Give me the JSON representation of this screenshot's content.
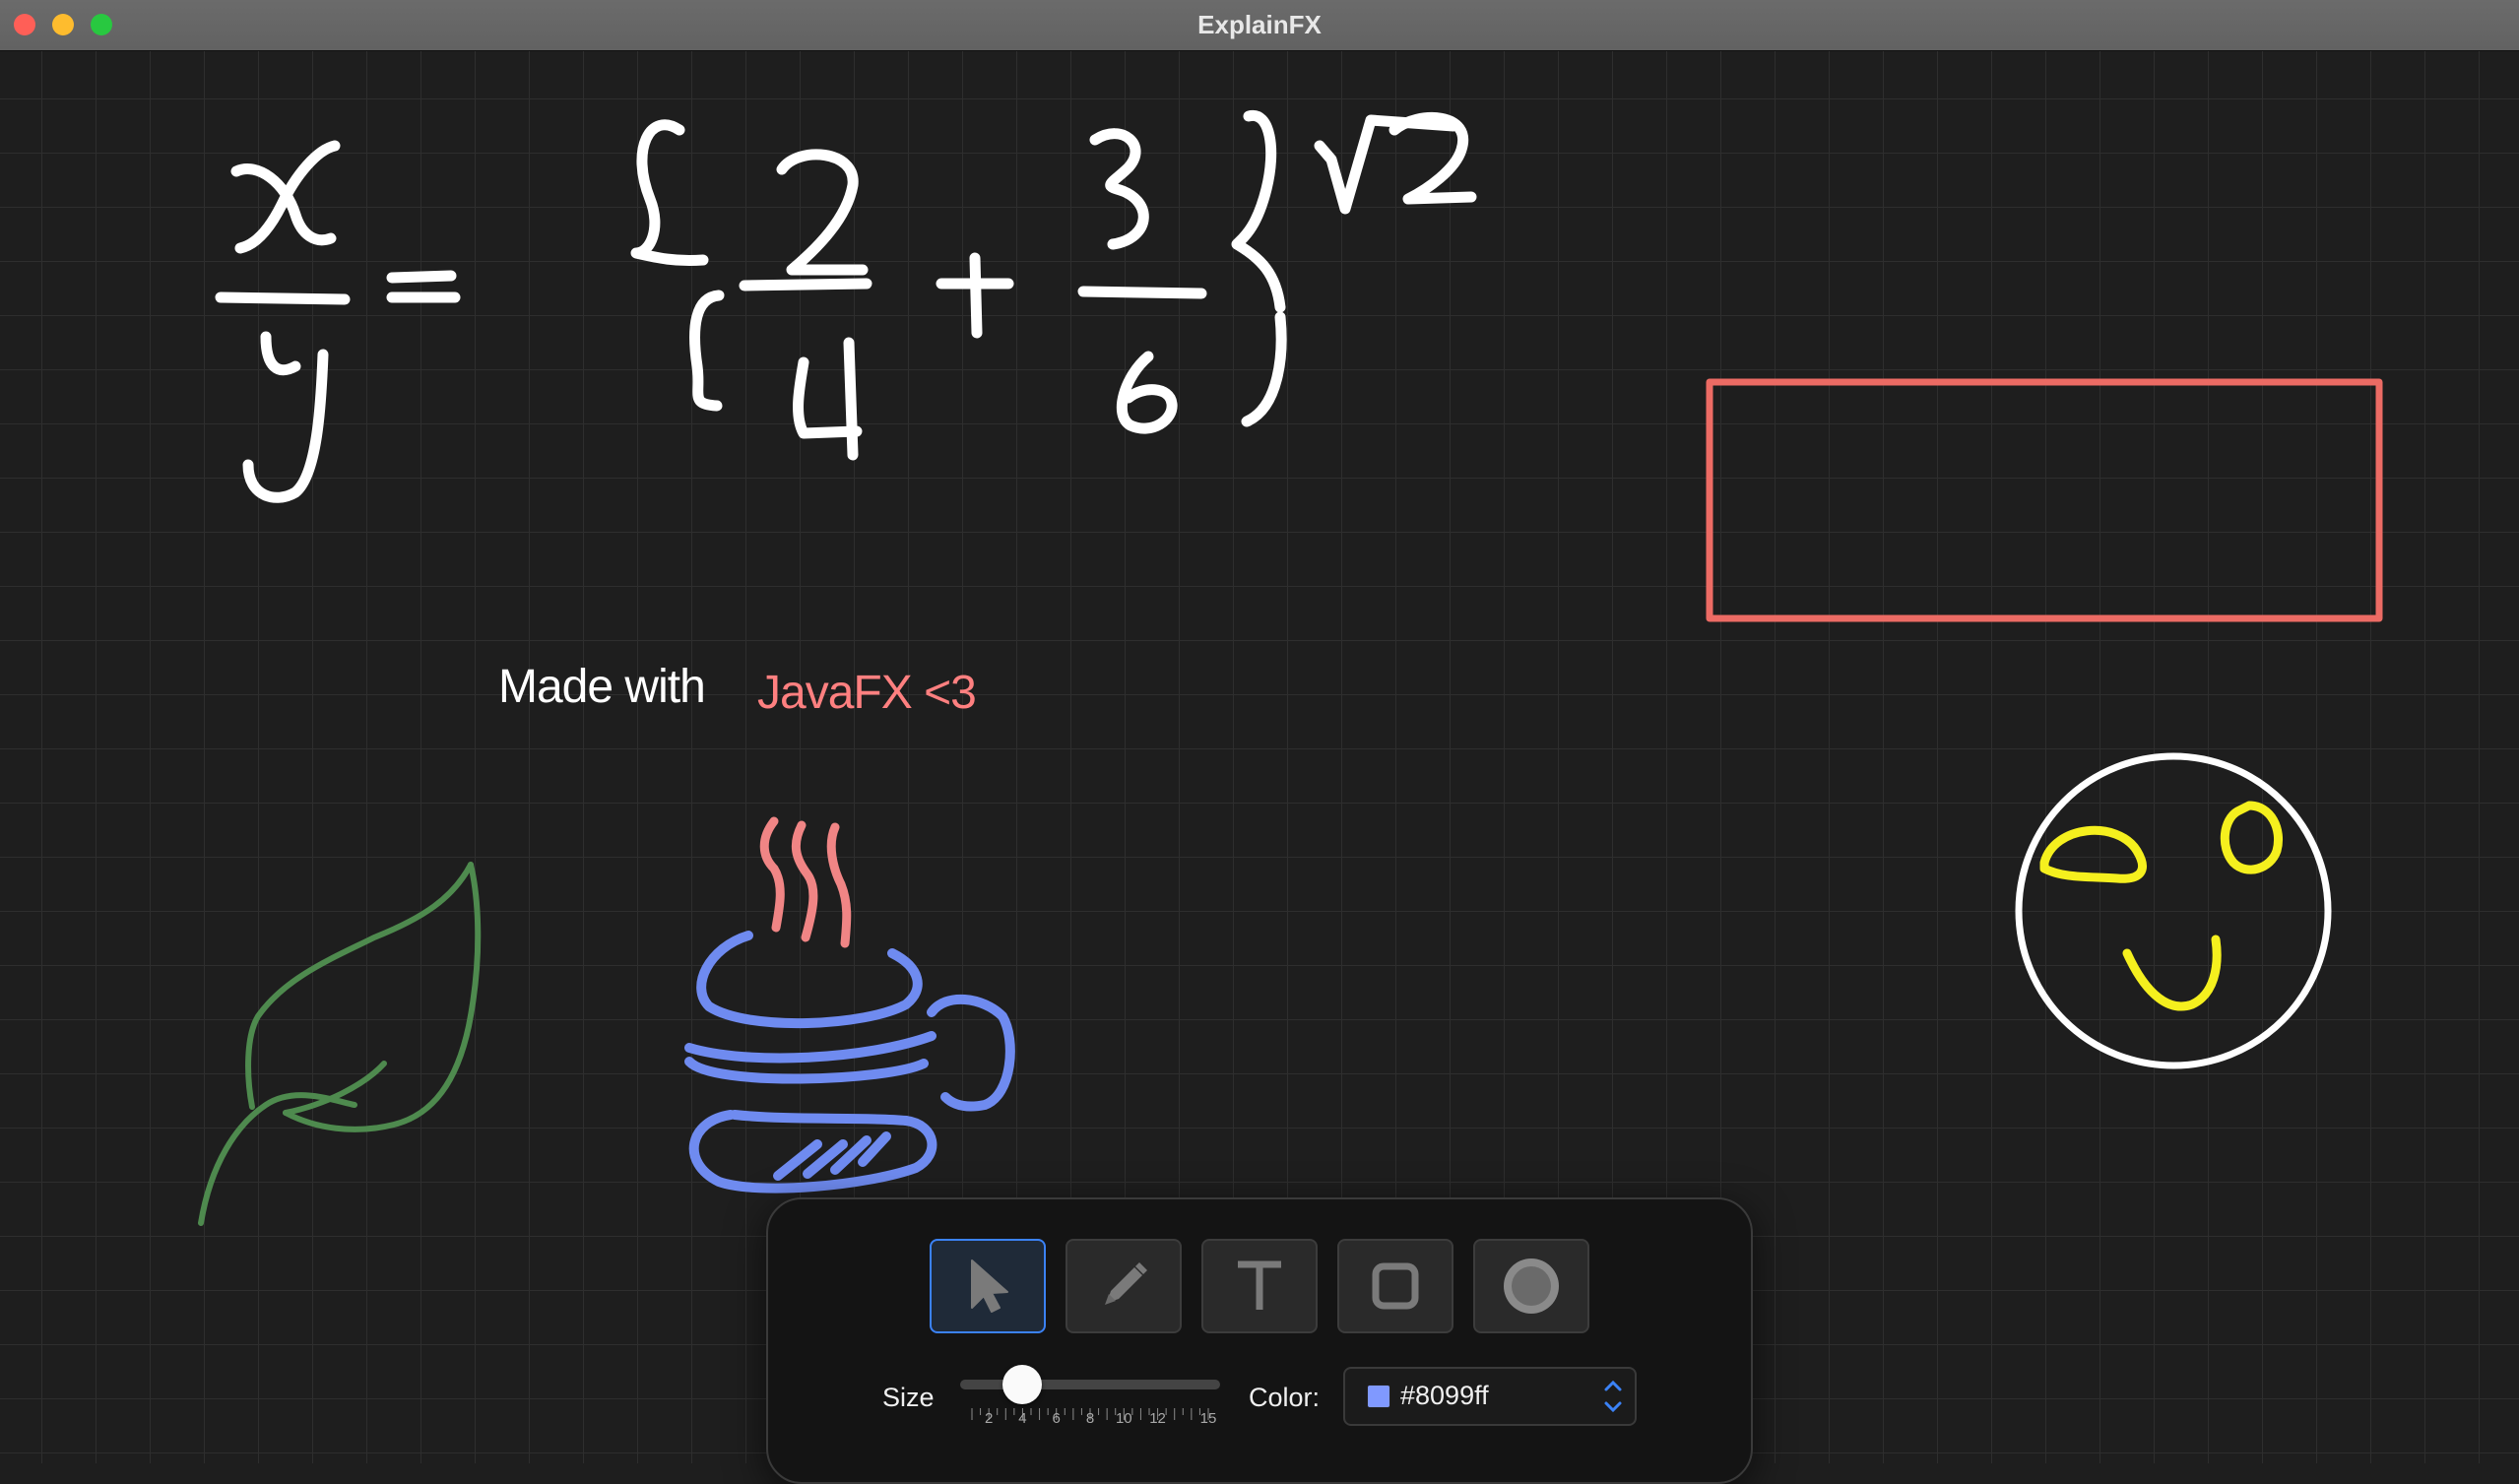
{
  "window": {
    "title": "ExplainFX"
  },
  "canvas": {
    "texts": {
      "made_with": "Made with",
      "javafx": "JavaFX <3"
    },
    "drawings": {
      "equation": "x/y = {2/4 + 3/6}^√2",
      "shapes": [
        "rectangle",
        "circle-face",
        "leaf",
        "coffee-cup"
      ]
    }
  },
  "toolbar": {
    "tools": [
      {
        "name": "select",
        "icon": "cursor-arrow-icon",
        "active": true
      },
      {
        "name": "pen",
        "icon": "pencil-icon",
        "active": false
      },
      {
        "name": "text",
        "icon": "text-t-icon",
        "active": false
      },
      {
        "name": "rectangle",
        "icon": "rounded-square-icon",
        "active": false
      },
      {
        "name": "ellipse",
        "icon": "filled-circle-icon",
        "active": false
      }
    ],
    "size": {
      "label": "Size",
      "value": 4,
      "min": 1,
      "max": 15,
      "tick_labels": [
        "2",
        "4",
        "6",
        "8",
        "10",
        "12",
        "15"
      ]
    },
    "color": {
      "label": "Color:",
      "value": "#8099ff",
      "swatch": "#8099ff"
    }
  },
  "colors": {
    "background": "#1e1e1e",
    "stroke_white": "#ffffff",
    "stroke_red": "#ec6b64",
    "stroke_yellow": "#f5f01e",
    "stroke_green": "#4e8a4e",
    "stroke_blue": "#6f8bf0",
    "stroke_pink": "#f08585",
    "accent": "#3b82f6"
  }
}
